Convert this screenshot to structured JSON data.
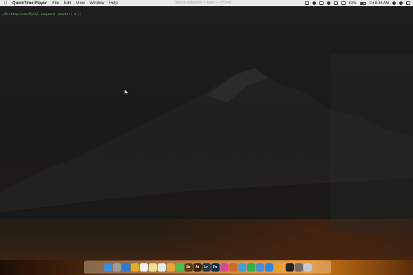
{
  "menubar": {
    "app_name": "QuickTime Player",
    "menus": [
      "File",
      "Edit",
      "View",
      "Window",
      "Help"
    ],
    "window_title": "MySql-swapment — bash — 270×42",
    "battery_percent": "63%",
    "clock": "Fri 8:48 AM"
  },
  "terminal": {
    "prompt": "~/Desktop/code/MySql-swapment (master) $ []"
  },
  "dock": {
    "apps": [
      {
        "name": "finder-icon",
        "color": "#3a8ee6",
        "label": ""
      },
      {
        "name": "launchpad-icon",
        "color": "#9b9b9b",
        "label": ""
      },
      {
        "name": "safari-icon",
        "color": "#2b7bd6",
        "label": ""
      },
      {
        "name": "chrome-icon",
        "color": "#e0b020",
        "label": ""
      },
      {
        "name": "calendar-icon",
        "color": "#f4f4f4",
        "label": ""
      },
      {
        "name": "notes-icon",
        "color": "#f3e08a",
        "label": ""
      },
      {
        "name": "reminders-icon",
        "color": "#ececec",
        "label": ""
      },
      {
        "name": "photos-icon",
        "color": "#e9a33a",
        "label": ""
      },
      {
        "name": "messages-icon",
        "color": "#4cc04c",
        "label": ""
      },
      {
        "name": "bridge-icon",
        "color": "#5a3a12",
        "label": "Br"
      },
      {
        "name": "illustrator-icon",
        "color": "#3a2408",
        "label": "Ai"
      },
      {
        "name": "lightroom-icon",
        "color": "#1e3a4a",
        "label": "Lr"
      },
      {
        "name": "photoshop-icon",
        "color": "#0f2b4a",
        "label": "Ps"
      },
      {
        "name": "itunes-icon",
        "color": "#d84a8c",
        "label": ""
      },
      {
        "name": "sublime-icon",
        "color": "#d2691e",
        "label": ""
      },
      {
        "name": "preview-icon",
        "color": "#3da3d6",
        "label": ""
      },
      {
        "name": "spotify-icon",
        "color": "#2fb24a",
        "label": ""
      },
      {
        "name": "xcode-icon",
        "color": "#4a8fd8",
        "label": ""
      },
      {
        "name": "appstore-icon",
        "color": "#2a8ad8",
        "label": ""
      },
      {
        "name": "sketch-icon",
        "color": "#f0a020",
        "label": ""
      },
      {
        "name": "terminal-icon",
        "color": "#222222",
        "label": ""
      },
      {
        "name": "downloads-icon",
        "color": "#6b6b6b",
        "label": ""
      },
      {
        "name": "trash-icon",
        "color": "#c8c8c8",
        "label": ""
      }
    ]
  }
}
